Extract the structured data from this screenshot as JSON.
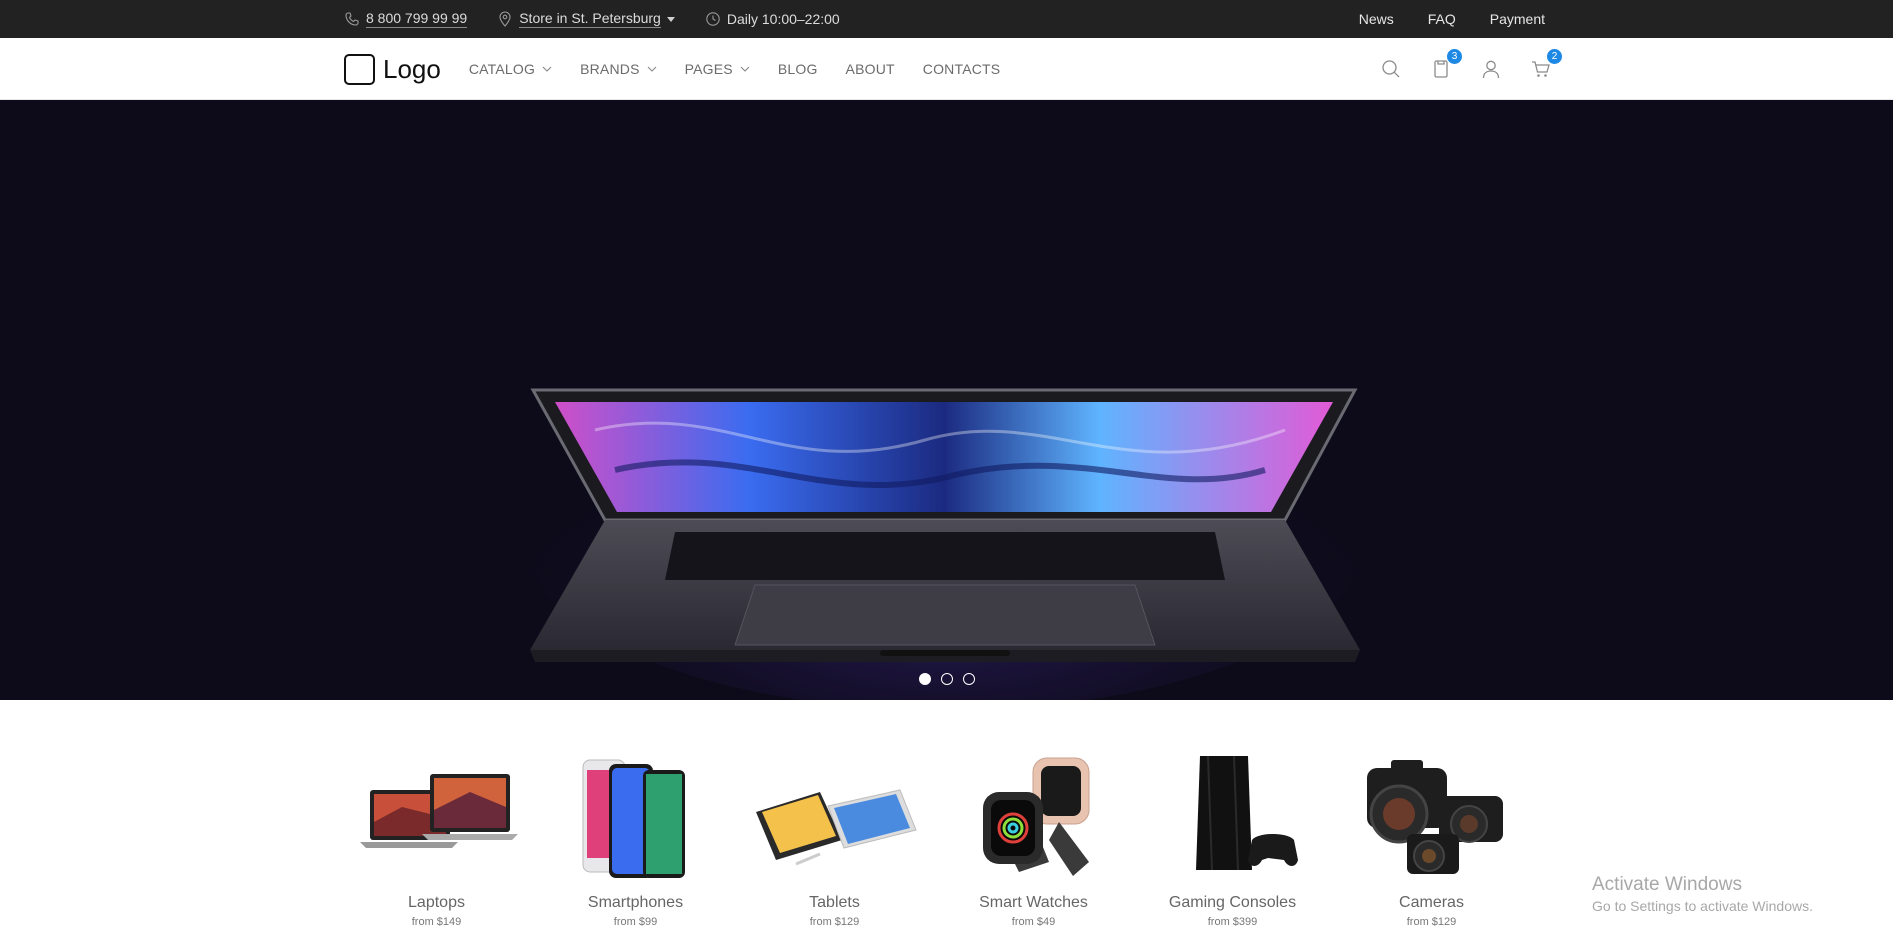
{
  "topbar": {
    "phone": "8 800 799 99 99",
    "store": "Store in St. Petersburg",
    "hours": "Daily 10:00–22:00",
    "links": [
      "News",
      "FAQ",
      "Payment"
    ]
  },
  "header": {
    "logo": "Logo",
    "nav": [
      {
        "label": "CATALOG",
        "dropdown": true
      },
      {
        "label": "BRANDS",
        "dropdown": true
      },
      {
        "label": "PAGES",
        "dropdown": true
      },
      {
        "label": "BLOG",
        "dropdown": false
      },
      {
        "label": "ABOUT",
        "dropdown": false
      },
      {
        "label": "CONTACTS",
        "dropdown": false
      }
    ],
    "icons": [
      "search-icon",
      "compare-icon",
      "user-icon",
      "cart-icon"
    ],
    "compare_count": "3",
    "cart_count": "2"
  },
  "hero": {
    "slides": 3,
    "active_slide": 1
  },
  "categories": [
    {
      "name": "Laptops",
      "price": "from $149"
    },
    {
      "name": "Smartphones",
      "price": "from $99"
    },
    {
      "name": "Tablets",
      "price": "from $129"
    },
    {
      "name": "Smart Watches",
      "price": "from $49"
    },
    {
      "name": "Gaming Consoles",
      "price": "from $399"
    },
    {
      "name": "Cameras",
      "price": "from $129"
    }
  ],
  "watermark": {
    "line1": "Activate Windows",
    "line2": "Go to Settings to activate Windows."
  },
  "colors": {
    "topbar_bg": "#222222",
    "hero_bg": "#0d0b1a",
    "accent": "#1e88e5"
  }
}
